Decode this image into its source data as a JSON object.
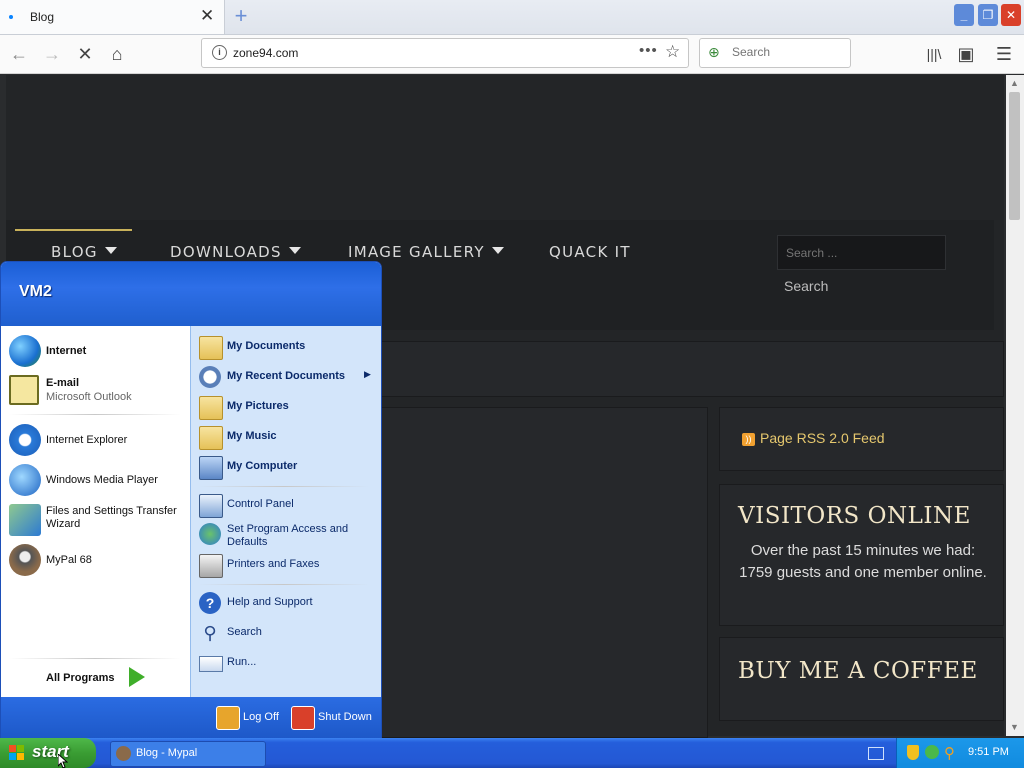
{
  "browser": {
    "tab_title": "Blog",
    "url": "zone94.com",
    "search_placeholder": "Search"
  },
  "site": {
    "menu": [
      "BLOG",
      "DOWNLOADS",
      "IMAGE GALLERY",
      "QUACK IT"
    ],
    "search_placeholder": "Search ...",
    "search_button": "Search",
    "rss_label": "Page RSS 2.0 Feed",
    "visitors_title": "VISITORS ONLINE",
    "visitors_text": "Over the past 15 minutes we had: 1759 guests and one member online.",
    "coffee_title": "BUY ME A COFFEE"
  },
  "start_menu": {
    "user": "VM2",
    "pinned": [
      {
        "label": "Internet",
        "sub": ""
      },
      {
        "label": "E-mail",
        "sub": "Microsoft Outlook"
      }
    ],
    "recent": [
      {
        "label": "Internet Explorer"
      },
      {
        "label": "Windows Media Player"
      },
      {
        "label": "Files and Settings Transfer Wizard"
      },
      {
        "label": "MyPal 68"
      }
    ],
    "all_programs": "All Programs",
    "places": [
      {
        "label": "My Documents"
      },
      {
        "label": "My Recent Documents"
      },
      {
        "label": "My Pictures"
      },
      {
        "label": "My Music"
      },
      {
        "label": "My Computer"
      }
    ],
    "system": [
      {
        "label": "Control Panel"
      },
      {
        "label": "Set Program Access and Defaults"
      },
      {
        "label": "Printers and Faxes"
      }
    ],
    "help": [
      {
        "label": "Help and Support"
      },
      {
        "label": "Search"
      },
      {
        "label": "Run..."
      }
    ],
    "log_off": "Log Off",
    "shut_down": "Shut Down"
  },
  "taskbar": {
    "start": "start",
    "task_label": "Blog - Mypal",
    "clock": "9:51 PM"
  },
  "colors": {
    "xp_blue": "#245edb",
    "start_green": "#3a9d33",
    "site_bg": "#232527",
    "gold_text": "#e6c86e"
  }
}
